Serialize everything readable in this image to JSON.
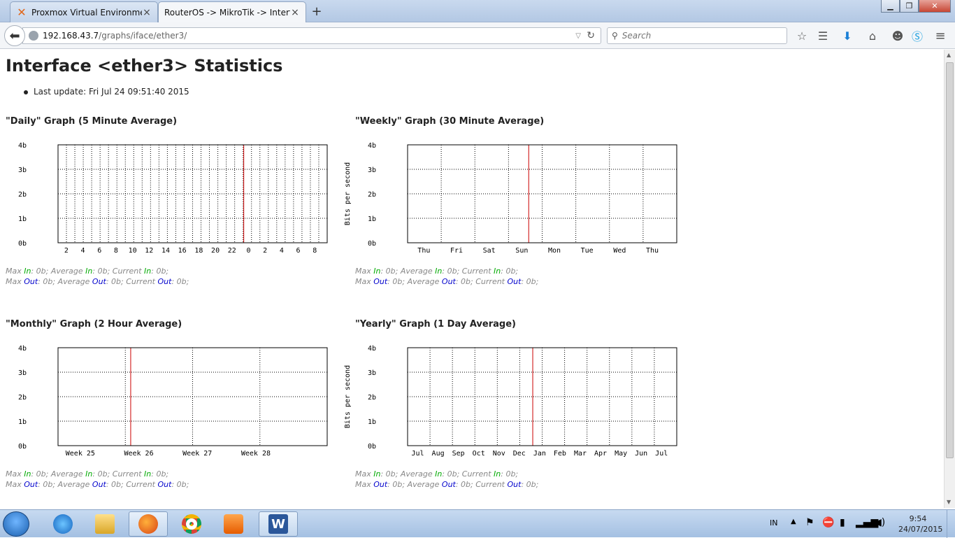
{
  "browser": {
    "tabs": [
      {
        "label": "Proxmox Virtual Environme...",
        "active": false
      },
      {
        "label": "RouterOS -> MikroTik -> Interf...",
        "active": true
      }
    ],
    "url_host": "192.168.43.7",
    "url_path": "/graphs/iface/ether3/",
    "search_placeholder": "Search"
  },
  "page": {
    "title": "Interface <ether3> Statistics",
    "last_update": "Last update: Fri Jul 24 09:51:40 2015"
  },
  "stats_text": {
    "max": "Max",
    "avg": "Average",
    "cur": "Current",
    "in": "In",
    "out": "Out",
    "val": ": 0b;"
  },
  "graphs": [
    {
      "title": "\"Daily\" Graph (5 Minute Average)",
      "ylabel": "",
      "y_ticks": [
        "4b",
        "3b",
        "2b",
        "1b",
        "0b"
      ],
      "x_ticks": [
        "2",
        "4",
        "6",
        "8",
        "10",
        "12",
        "14",
        "16",
        "18",
        "20",
        "22",
        "0",
        "2",
        "4",
        "6",
        "8"
      ],
      "now_fraction": 0.69,
      "minor_lines": 32
    },
    {
      "title": "\"Weekly\" Graph (30 Minute Average)",
      "ylabel": "Bits per second",
      "y_ticks": [
        "4b",
        "3b",
        "2b",
        "1b",
        "0b"
      ],
      "x_ticks": [
        "Thu",
        "Fri",
        "Sat",
        "Sun",
        "Mon",
        "Tue",
        "Wed",
        "Thu"
      ],
      "now_fraction": 0.45,
      "minor_lines": 8
    },
    {
      "title": "\"Monthly\" Graph (2 Hour Average)",
      "ylabel": "",
      "y_ticks": [
        "4b",
        "3b",
        "2b",
        "1b",
        "0b"
      ],
      "x_ticks": [
        "Week 25",
        "Week 26",
        "Week 27",
        "Week 28"
      ],
      "now_fraction": 0.27,
      "minor_lines": 4
    },
    {
      "title": "\"Yearly\" Graph (1 Day Average)",
      "ylabel": "Bits per second",
      "y_ticks": [
        "4b",
        "3b",
        "2b",
        "1b",
        "0b"
      ],
      "x_ticks": [
        "Jul",
        "Aug",
        "Sep",
        "Oct",
        "Nov",
        "Dec",
        "Jan",
        "Feb",
        "Mar",
        "Apr",
        "May",
        "Jun",
        "Jul"
      ],
      "now_fraction": 0.465,
      "minor_lines": 12
    }
  ],
  "chart_data": [
    {
      "type": "line",
      "title": "\"Daily\" Graph (5 Minute Average)",
      "ylabel": "",
      "ylim": [
        0,
        4
      ],
      "y_ticks": [
        "0b",
        "1b",
        "2b",
        "3b",
        "4b"
      ],
      "x": [
        "2",
        "4",
        "6",
        "8",
        "10",
        "12",
        "14",
        "16",
        "18",
        "20",
        "22",
        "0",
        "2",
        "4",
        "6",
        "8"
      ],
      "series": [
        {
          "name": "In",
          "values": [
            0
          ]
        },
        {
          "name": "Out",
          "values": [
            0
          ]
        }
      ],
      "grid": true
    },
    {
      "type": "line",
      "title": "\"Weekly\" Graph (30 Minute Average)",
      "ylabel": "Bits per second",
      "ylim": [
        0,
        4
      ],
      "y_ticks": [
        "0b",
        "1b",
        "2b",
        "3b",
        "4b"
      ],
      "x": [
        "Thu",
        "Fri",
        "Sat",
        "Sun",
        "Mon",
        "Tue",
        "Wed",
        "Thu"
      ],
      "series": [
        {
          "name": "In",
          "values": [
            0
          ]
        },
        {
          "name": "Out",
          "values": [
            0
          ]
        }
      ],
      "grid": true
    },
    {
      "type": "line",
      "title": "\"Monthly\" Graph (2 Hour Average)",
      "ylabel": "",
      "ylim": [
        0,
        4
      ],
      "y_ticks": [
        "0b",
        "1b",
        "2b",
        "3b",
        "4b"
      ],
      "x": [
        "Week 25",
        "Week 26",
        "Week 27",
        "Week 28"
      ],
      "series": [
        {
          "name": "In",
          "values": [
            0
          ]
        },
        {
          "name": "Out",
          "values": [
            0
          ]
        }
      ],
      "grid": true
    },
    {
      "type": "line",
      "title": "\"Yearly\" Graph (1 Day Average)",
      "ylabel": "Bits per second",
      "ylim": [
        0,
        4
      ],
      "y_ticks": [
        "0b",
        "1b",
        "2b",
        "3b",
        "4b"
      ],
      "x": [
        "Jul",
        "Aug",
        "Sep",
        "Oct",
        "Nov",
        "Dec",
        "Jan",
        "Feb",
        "Mar",
        "Apr",
        "May",
        "Jun",
        "Jul"
      ],
      "series": [
        {
          "name": "In",
          "values": [
            0
          ]
        },
        {
          "name": "Out",
          "values": [
            0
          ]
        }
      ],
      "grid": true
    }
  ],
  "taskbar": {
    "lang": "IN",
    "time": "9:54",
    "date": "24/07/2015"
  },
  "colors": {
    "in": "#00aa00",
    "out": "#0000cc",
    "now_line": "#cc0000",
    "grid": "#000000"
  },
  "icons": [
    "back-arrow-icon",
    "globe-icon",
    "reload-icon",
    "search-icon",
    "star-icon",
    "reading-list-icon",
    "download-icon",
    "home-icon",
    "chat-icon",
    "skype-icon",
    "menu-icon",
    "windows-start-icon",
    "ie-icon",
    "explorer-icon",
    "firefox-icon",
    "chrome-icon",
    "media-player-icon",
    "word-icon"
  ]
}
